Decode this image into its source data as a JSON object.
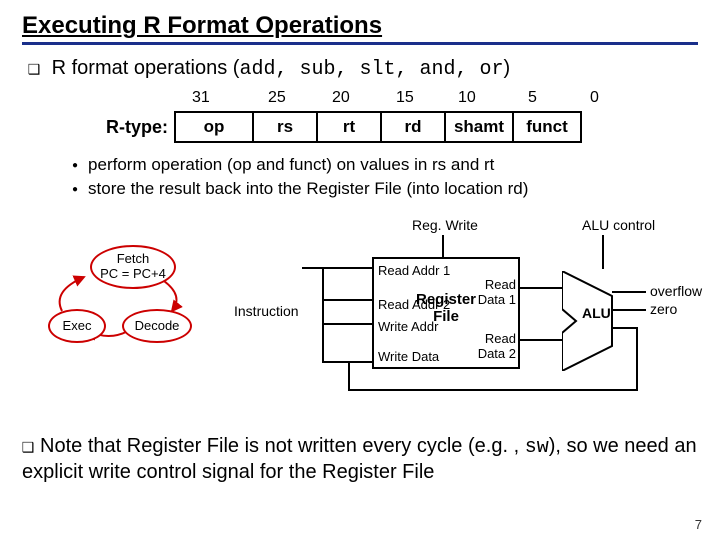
{
  "title": "Executing R Format Operations",
  "bullet1_prefix": "R format operations (",
  "bullet1_ops": "add, sub, slt, and, or",
  "bullet1_suffix": ")",
  "bit_positions": {
    "b31": "31",
    "b25": "25",
    "b20": "20",
    "b15": "15",
    "b10": "10",
    "b5": "5",
    "b0": "0"
  },
  "field_row_label": "R-type:",
  "fields": {
    "op": "op",
    "rs": "rs",
    "rt": "rt",
    "rd": "rd",
    "shamt": "shamt",
    "funct": "funct"
  },
  "sub_bullets": {
    "b1": "perform operation (op and funct) on values in rs and rt",
    "b2": "store the result back into the Register File (into location rd)"
  },
  "signals": {
    "regwrite": "Reg. Write",
    "alucontrol": "ALU control"
  },
  "cycle": {
    "fetch_line1": "Fetch",
    "fetch_line2": "PC = PC+4",
    "exec": "Exec",
    "decode": "Decode"
  },
  "instruction_label": "Instruction",
  "regfile": {
    "center_l1": "Register",
    "center_l2": "File",
    "read_addr1": "Read Addr 1",
    "read_addr2": "Read Addr 2",
    "write_addr": "Write Addr",
    "write_data": "Write Data",
    "read_data1_l1": "Read",
    "read_data1_l2": "Data 1",
    "read_data2_l1": "Read",
    "read_data2_l2": "Data 2"
  },
  "alu_label": "ALU",
  "alu_outputs": {
    "overflow": "overflow",
    "zero": "zero"
  },
  "note_prefix": "Note that Register File is not written every cycle (e.g. , ",
  "note_mono": "sw",
  "note_suffix": "), so we need an explicit write control signal for the Register File",
  "page_number": "7"
}
